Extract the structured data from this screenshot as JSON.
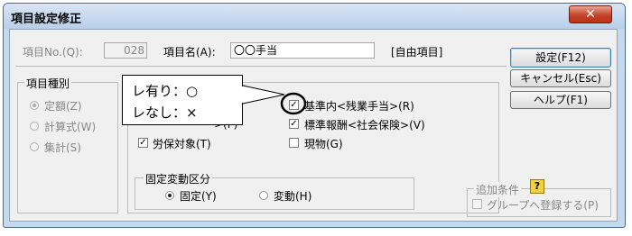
{
  "window": {
    "title": "項目設定修正",
    "close_glyph": "✕"
  },
  "item_no": {
    "label": "項目No.(Q):",
    "value": "028"
  },
  "item_name": {
    "label": "項目名(A):",
    "value": "〇〇手当"
  },
  "free_item_tag": "[自由項目]",
  "buttons": {
    "settings": "設定(F12)",
    "cancel": "キャンセル(Esc)",
    "help": "ヘルプ(F1)"
  },
  "item_type": {
    "legend": "項目種別",
    "options": [
      {
        "label": "定額(Z)",
        "selected": true
      },
      {
        "label": "計算式(W)",
        "selected": false
      },
      {
        "label": "集計(S)",
        "selected": false
      }
    ]
  },
  "checks": {
    "partial_label": ">(F)",
    "labor_insurance": {
      "label": "労保対象(T)",
      "checked": true
    },
    "standard_inside": {
      "label": "基準内<残業手当>(R)",
      "checked": true
    },
    "standard_remuneration": {
      "label": "標準報酬<社会保険>(V)",
      "checked": true
    },
    "in_kind": {
      "label": "現物(G)",
      "checked": false
    }
  },
  "fixed_variable": {
    "legend": "固定変動区分",
    "options": [
      {
        "label": "固定(Y)",
        "selected": true
      },
      {
        "label": "変動(H)",
        "selected": false
      }
    ]
  },
  "extra_conditions": {
    "legend": "追加条件",
    "help_glyph": "?",
    "group_register": {
      "label": "グループへ登録する(P)",
      "checked": false
    }
  },
  "callout": {
    "line1": "レ有り：○",
    "line2": "レなし：×"
  }
}
